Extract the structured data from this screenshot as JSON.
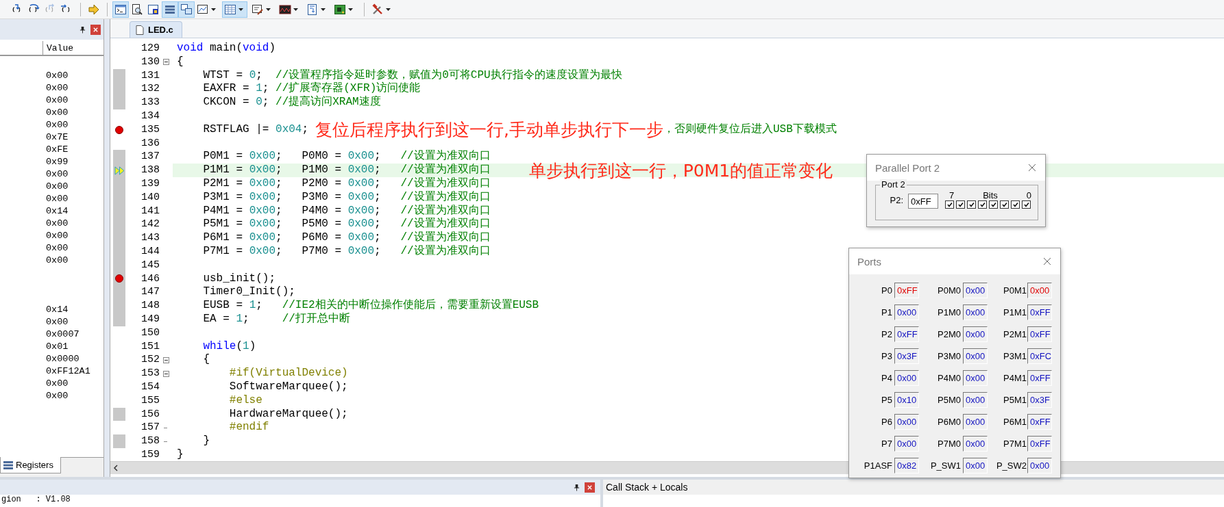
{
  "toolbar": [
    {
      "kind": "step_into",
      "selected": false,
      "disabled": false,
      "dropdown": false
    },
    {
      "kind": "step_over",
      "selected": false,
      "disabled": false,
      "dropdown": false
    },
    {
      "kind": "step_out",
      "selected": false,
      "disabled": true,
      "dropdown": false
    },
    {
      "kind": "run_to_cursor",
      "selected": false,
      "disabled": false,
      "dropdown": false
    },
    {
      "kind": "separator"
    },
    {
      "kind": "show_next",
      "selected": false,
      "disabled": false,
      "dropdown": false
    },
    {
      "kind": "separator"
    },
    {
      "kind": "command",
      "selected": true,
      "disabled": false,
      "dropdown": false
    },
    {
      "kind": "disassembly",
      "selected": false,
      "disabled": false,
      "dropdown": false
    },
    {
      "kind": "symbols",
      "selected": false,
      "disabled": false,
      "dropdown": false
    },
    {
      "kind": "registers",
      "selected": true,
      "disabled": false,
      "dropdown": false
    },
    {
      "kind": "call_stack",
      "selected": true,
      "disabled": false,
      "dropdown": false
    },
    {
      "kind": "watch",
      "selected": false,
      "disabled": false,
      "dropdown": true
    },
    {
      "kind": "memory",
      "selected": true,
      "disabled": false,
      "dropdown": true
    },
    {
      "kind": "serial",
      "selected": false,
      "disabled": false,
      "dropdown": true
    },
    {
      "kind": "logic_analyzer",
      "selected": false,
      "disabled": false,
      "dropdown": true
    },
    {
      "kind": "trace",
      "selected": false,
      "disabled": false,
      "dropdown": true
    },
    {
      "kind": "system_viewer",
      "selected": false,
      "disabled": false,
      "dropdown": true
    },
    {
      "kind": "separator"
    },
    {
      "kind": "toolbox",
      "selected": false,
      "disabled": false,
      "dropdown": true
    }
  ],
  "register_panel": {
    "column_header": "Value",
    "groups": [
      [
        "0x00",
        "0x00",
        "0x00",
        "0x00",
        "0x00",
        "0x7E",
        "0xFE",
        "0x99",
        "0x00",
        "0x00",
        "0x00",
        "0x14",
        "0x00",
        "0x00",
        "0x00",
        "0x00"
      ],
      [
        "0x14",
        "0x00",
        "0x0007",
        "0x01",
        "0x0000",
        "0xFF12A1",
        "0x00",
        "0x00"
      ]
    ],
    "tab": "Registers"
  },
  "editor": {
    "tab": "LED.c",
    "lines": [
      {
        "no": "129",
        "kind": "plain",
        "exec": false,
        "breakpoint": false,
        "current": false,
        "tokens": [
          {
            "kind": "kw",
            "t": "void"
          },
          {
            "kind": "plain",
            "t": " main("
          },
          {
            "kind": "kw",
            "t": "void"
          },
          {
            "kind": "plain",
            "t": ")"
          }
        ]
      },
      {
        "no": "130",
        "kind": "fold_start",
        "exec": false,
        "breakpoint": false,
        "current": false,
        "tokens": [
          {
            "kind": "plain",
            "t": "{"
          }
        ]
      },
      {
        "no": "131",
        "kind": "plain",
        "exec": true,
        "breakpoint": false,
        "current": false,
        "tokens": [
          {
            "kind": "plain",
            "t": "    WTST = "
          },
          {
            "kind": "num",
            "t": "0"
          },
          {
            "kind": "plain",
            "t": ";  "
          },
          {
            "kind": "cmt",
            "t": "//设置程序指令延时参数，赋值为0可将CPU执行指令的速度设置为最快"
          }
        ]
      },
      {
        "no": "132",
        "kind": "plain",
        "exec": true,
        "breakpoint": false,
        "current": false,
        "tokens": [
          {
            "kind": "plain",
            "t": "    EAXFR = "
          },
          {
            "kind": "num",
            "t": "1"
          },
          {
            "kind": "plain",
            "t": "; "
          },
          {
            "kind": "cmt",
            "t": "//扩展寄存器(XFR)访问使能"
          }
        ]
      },
      {
        "no": "133",
        "kind": "plain",
        "exec": true,
        "breakpoint": false,
        "current": false,
        "tokens": [
          {
            "kind": "plain",
            "t": "    CKCON = "
          },
          {
            "kind": "num",
            "t": "0"
          },
          {
            "kind": "plain",
            "t": "; "
          },
          {
            "kind": "cmt",
            "t": "//提高访问XRAM速度"
          }
        ]
      },
      {
        "no": "134",
        "kind": "plain",
        "exec": false,
        "breakpoint": false,
        "current": false
      },
      {
        "no": "135",
        "kind": "plain",
        "exec": false,
        "breakpoint": true,
        "current": false,
        "tokens": [
          {
            "kind": "plain",
            "t": "    RSTFLAG |= "
          },
          {
            "kind": "num",
            "t": "0x04"
          },
          {
            "kind": "plain",
            "t": ";"
          }
        ],
        "note": "复位后程序执行到这一行,手动单步执行下一步",
        "tail": "，否则硬件复位后进入USB下载模式"
      },
      {
        "no": "136",
        "kind": "plain",
        "exec": false,
        "breakpoint": false,
        "current": false
      },
      {
        "no": "137",
        "kind": "plain",
        "exec": true,
        "breakpoint": false,
        "current": false,
        "tokens": [
          {
            "kind": "plain",
            "t": "    P0M1 = "
          },
          {
            "kind": "num",
            "t": "0x00"
          },
          {
            "kind": "plain",
            "t": ";   P0M0 = "
          },
          {
            "kind": "num",
            "t": "0x00"
          },
          {
            "kind": "plain",
            "t": ";   "
          },
          {
            "kind": "cmt",
            "t": "//设置为准双向口"
          }
        ]
      },
      {
        "no": "138",
        "kind": "plain",
        "exec": true,
        "breakpoint": false,
        "current": true,
        "tokens": [
          {
            "kind": "plain",
            "t": "    P1M1 = "
          },
          {
            "kind": "num",
            "t": "0x00"
          },
          {
            "kind": "plain",
            "t": ";   P1M0 = "
          },
          {
            "kind": "num",
            "t": "0x00"
          },
          {
            "kind": "plain",
            "t": ";   "
          },
          {
            "kind": "cmt",
            "t": "//设置为准双向口"
          }
        ],
        "note": "单步执行到这一行，P0M1的值正常变化"
      },
      {
        "no": "139",
        "kind": "plain",
        "exec": true,
        "breakpoint": false,
        "current": false,
        "tokens": [
          {
            "kind": "plain",
            "t": "    P2M1 = "
          },
          {
            "kind": "num",
            "t": "0x00"
          },
          {
            "kind": "plain",
            "t": ";   P2M0 = "
          },
          {
            "kind": "num",
            "t": "0x00"
          },
          {
            "kind": "plain",
            "t": ";   "
          },
          {
            "kind": "cmt",
            "t": "//设置为准双向口"
          }
        ]
      },
      {
        "no": "140",
        "kind": "plain",
        "exec": true,
        "breakpoint": false,
        "current": false,
        "tokens": [
          {
            "kind": "plain",
            "t": "    P3M1 = "
          },
          {
            "kind": "num",
            "t": "0x00"
          },
          {
            "kind": "plain",
            "t": ";   P3M0 = "
          },
          {
            "kind": "num",
            "t": "0x00"
          },
          {
            "kind": "plain",
            "t": ";   "
          },
          {
            "kind": "cmt",
            "t": "//设置为准双向口"
          }
        ]
      },
      {
        "no": "141",
        "kind": "plain",
        "exec": true,
        "breakpoint": false,
        "current": false,
        "tokens": [
          {
            "kind": "plain",
            "t": "    P4M1 = "
          },
          {
            "kind": "num",
            "t": "0x00"
          },
          {
            "kind": "plain",
            "t": ";   P4M0 = "
          },
          {
            "kind": "num",
            "t": "0x00"
          },
          {
            "kind": "plain",
            "t": ";   "
          },
          {
            "kind": "cmt",
            "t": "//设置为准双向口"
          }
        ]
      },
      {
        "no": "142",
        "kind": "plain",
        "exec": true,
        "breakpoint": false,
        "current": false,
        "tokens": [
          {
            "kind": "plain",
            "t": "    P5M1 = "
          },
          {
            "kind": "num",
            "t": "0x00"
          },
          {
            "kind": "plain",
            "t": ";   P5M0 = "
          },
          {
            "kind": "num",
            "t": "0x00"
          },
          {
            "kind": "plain",
            "t": ";   "
          },
          {
            "kind": "cmt",
            "t": "//设置为准双向口"
          }
        ]
      },
      {
        "no": "143",
        "kind": "plain",
        "exec": true,
        "breakpoint": false,
        "current": false,
        "tokens": [
          {
            "kind": "plain",
            "t": "    P6M1 = "
          },
          {
            "kind": "num",
            "t": "0x00"
          },
          {
            "kind": "plain",
            "t": ";   P6M0 = "
          },
          {
            "kind": "num",
            "t": "0x00"
          },
          {
            "kind": "plain",
            "t": ";   "
          },
          {
            "kind": "cmt",
            "t": "//设置为准双向口"
          }
        ]
      },
      {
        "no": "144",
        "kind": "plain",
        "exec": true,
        "breakpoint": false,
        "current": false,
        "tokens": [
          {
            "kind": "plain",
            "t": "    P7M1 = "
          },
          {
            "kind": "num",
            "t": "0x00"
          },
          {
            "kind": "plain",
            "t": ";   P7M0 = "
          },
          {
            "kind": "num",
            "t": "0x00"
          },
          {
            "kind": "plain",
            "t": ";   "
          },
          {
            "kind": "cmt",
            "t": "//设置为准双向口"
          }
        ]
      },
      {
        "no": "145",
        "kind": "plain",
        "exec": true,
        "breakpoint": false,
        "current": false
      },
      {
        "no": "146",
        "kind": "plain",
        "exec": true,
        "breakpoint": true,
        "current": false,
        "tokens": [
          {
            "kind": "plain",
            "t": "    usb_init();"
          }
        ]
      },
      {
        "no": "147",
        "kind": "plain",
        "exec": true,
        "breakpoint": false,
        "current": false,
        "tokens": [
          {
            "kind": "plain",
            "t": "    Timer0_Init();"
          }
        ]
      },
      {
        "no": "148",
        "kind": "plain",
        "exec": true,
        "breakpoint": false,
        "current": false,
        "tokens": [
          {
            "kind": "plain",
            "t": "    EUSB = "
          },
          {
            "kind": "num",
            "t": "1"
          },
          {
            "kind": "plain",
            "t": ";   "
          },
          {
            "kind": "cmt",
            "t": "//IE2相关的中断位操作使能后，需要重新设置EUSB"
          }
        ]
      },
      {
        "no": "149",
        "kind": "plain",
        "exec": true,
        "breakpoint": false,
        "current": false,
        "tokens": [
          {
            "kind": "plain",
            "t": "    EA = "
          },
          {
            "kind": "num",
            "t": "1"
          },
          {
            "kind": "plain",
            "t": ";     "
          },
          {
            "kind": "cmt",
            "t": "//打开总中断"
          }
        ]
      },
      {
        "no": "150",
        "kind": "plain",
        "exec": false,
        "breakpoint": false,
        "current": false
      },
      {
        "no": "151",
        "kind": "plain",
        "exec": false,
        "breakpoint": false,
        "current": false,
        "tokens": [
          {
            "kind": "kw",
            "t": "    while"
          },
          {
            "kind": "plain",
            "t": "("
          },
          {
            "kind": "num",
            "t": "1"
          },
          {
            "kind": "plain",
            "t": ")"
          }
        ]
      },
      {
        "no": "152",
        "kind": "fold_start",
        "exec": false,
        "breakpoint": false,
        "current": false,
        "tokens": [
          {
            "kind": "plain",
            "t": "    {"
          }
        ]
      },
      {
        "no": "153",
        "kind": "fold_start",
        "exec": false,
        "breakpoint": false,
        "current": false,
        "tokens": [
          {
            "kind": "pre",
            "t": "        #if(VirtualDevice)"
          }
        ]
      },
      {
        "no": "154",
        "kind": "plain",
        "exec": false,
        "breakpoint": false,
        "current": false,
        "tokens": [
          {
            "kind": "plain",
            "t": "        SoftwareMarquee();"
          }
        ]
      },
      {
        "no": "155",
        "kind": "plain",
        "exec": false,
        "breakpoint": false,
        "current": false,
        "tokens": [
          {
            "kind": "pre",
            "t": "        #else"
          }
        ]
      },
      {
        "no": "156",
        "kind": "plain",
        "exec": true,
        "breakpoint": false,
        "current": false,
        "tokens": [
          {
            "kind": "plain",
            "t": "        HardwareMarquee();"
          }
        ]
      },
      {
        "no": "157",
        "kind": "fold_end",
        "exec": false,
        "breakpoint": false,
        "current": false,
        "tokens": [
          {
            "kind": "pre",
            "t": "        #endif"
          }
        ]
      },
      {
        "no": "158",
        "kind": "fold_end",
        "exec": true,
        "breakpoint": false,
        "current": false,
        "tokens": [
          {
            "kind": "plain",
            "t": "    }"
          }
        ]
      },
      {
        "no": "159",
        "kind": "plain",
        "exec": false,
        "breakpoint": false,
        "current": false,
        "tokens": [
          {
            "kind": "plain",
            "t": "}"
          }
        ]
      }
    ]
  },
  "parallel_port": {
    "title": "Parallel Port 2",
    "group": "Port 2",
    "label": "P2:",
    "value": "0xFF",
    "bit_high": "7",
    "bits_label": "Bits",
    "bit_low": "0",
    "bits": [
      {
        "checked": true
      },
      {
        "checked": true
      },
      {
        "checked": true
      },
      {
        "checked": true
      },
      {
        "checked": true
      },
      {
        "checked": true
      },
      {
        "checked": true
      },
      {
        "checked": true
      }
    ]
  },
  "ports": {
    "title": "Ports",
    "rows": [
      [
        {
          "label": "P0",
          "value": "0xFF",
          "changed": true
        },
        {
          "label": "P0M0",
          "value": "0x00",
          "changed": false
        },
        {
          "label": "P0M1",
          "value": "0x00",
          "changed": true
        }
      ],
      [
        {
          "label": "P1",
          "value": "0x00",
          "changed": false
        },
        {
          "label": "P1M0",
          "value": "0x00",
          "changed": false
        },
        {
          "label": "P1M1",
          "value": "0xFF",
          "changed": false
        }
      ],
      [
        {
          "label": "P2",
          "value": "0xFF",
          "changed": false
        },
        {
          "label": "P2M0",
          "value": "0x00",
          "changed": false
        },
        {
          "label": "P2M1",
          "value": "0xFF",
          "changed": false
        }
      ],
      [
        {
          "label": "P3",
          "value": "0x3F",
          "changed": false
        },
        {
          "label": "P3M0",
          "value": "0x00",
          "changed": false
        },
        {
          "label": "P3M1",
          "value": "0xFC",
          "changed": false
        }
      ],
      [
        {
          "label": "P4",
          "value": "0x00",
          "changed": false
        },
        {
          "label": "P4M0",
          "value": "0x00",
          "changed": false
        },
        {
          "label": "P4M1",
          "value": "0xFF",
          "changed": false
        }
      ],
      [
        {
          "label": "P5",
          "value": "0x10",
          "changed": false
        },
        {
          "label": "P5M0",
          "value": "0x00",
          "changed": false
        },
        {
          "label": "P5M1",
          "value": "0x3F",
          "changed": false
        }
      ],
      [
        {
          "label": "P6",
          "value": "0x00",
          "changed": false
        },
        {
          "label": "P6M0",
          "value": "0x00",
          "changed": false
        },
        {
          "label": "P6M1",
          "value": "0xFF",
          "changed": false
        }
      ],
      [
        {
          "label": "P7",
          "value": "0x00",
          "changed": false
        },
        {
          "label": "P7M0",
          "value": "0x00",
          "changed": false
        },
        {
          "label": "P7M1",
          "value": "0xFF",
          "changed": false
        }
      ],
      [
        {
          "label": "P1ASF",
          "value": "0x82",
          "changed": false
        },
        {
          "label": "P_SW1",
          "value": "0x00",
          "changed": false
        },
        {
          "label": "P_SW2",
          "value": "0x00",
          "changed": false
        }
      ]
    ]
  },
  "output_panel": {
    "text": "gion   : V1.08"
  },
  "call_stack_panel": {
    "title": "Call Stack + Locals"
  }
}
